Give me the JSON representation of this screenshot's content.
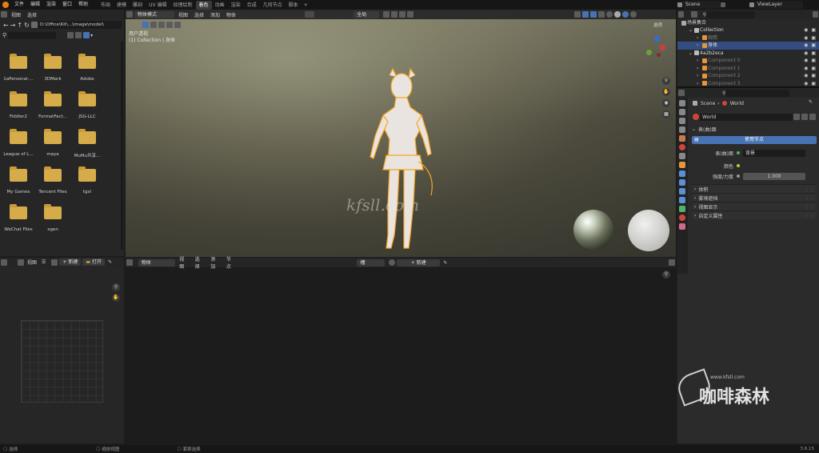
{
  "menu": [
    "文件",
    "编辑",
    "渲染",
    "窗口",
    "帮助"
  ],
  "workspaces": [
    {
      "label": "布局",
      "active": false
    },
    {
      "label": "建模",
      "active": false
    },
    {
      "label": "雕刻",
      "active": false
    },
    {
      "label": "UV 编辑",
      "active": false
    },
    {
      "label": "纹理绘制",
      "active": false
    },
    {
      "label": "着色",
      "active": true
    },
    {
      "label": "动画",
      "active": false
    },
    {
      "label": "渲染",
      "active": false
    },
    {
      "label": "合成",
      "active": false
    },
    {
      "label": "几何节点",
      "active": false
    },
    {
      "label": "脚本",
      "active": false
    }
  ],
  "scene": "Scene",
  "view_layer": "ViewLayer",
  "file_browser": {
    "menu": [
      "视图",
      "选择"
    ],
    "path": "D:\\Office\\Kit\\...\\image\\model\\",
    "folders": [
      "1aPersonal-...",
      "3DMark",
      "Adobe",
      "Fiddler2",
      "FormatFact...",
      "JSG-LLC",
      "League of L...",
      "maya",
      "MuMu共享...",
      "My Games",
      "Tencent Files",
      "tgxl",
      "WeChat Files",
      "xgen"
    ]
  },
  "viewport": {
    "mode": "物体模式",
    "menu": [
      "视图",
      "选择",
      "添加",
      "物体"
    ],
    "transform": "全局",
    "overlay_title": "用户透视",
    "overlay_sub": "(1) Collection | 身体",
    "options": "选项",
    "watermark": "kfsll.com"
  },
  "image_editor": {
    "menu": [
      "视图"
    ],
    "new_label": "新建",
    "open_label": "打开"
  },
  "node_editor": {
    "type": "物体",
    "menu": [
      "视图",
      "选择",
      "添加",
      "节点"
    ],
    "slot": "槽",
    "new_label": "新建"
  },
  "outliner": {
    "root": "场景集合",
    "items": [
      {
        "label": "Collection",
        "depth": 1,
        "selected": false,
        "dim": false
      },
      {
        "label": "眼睛",
        "depth": 2,
        "selected": false,
        "dim": true
      },
      {
        "label": "身体",
        "depth": 2,
        "selected": true,
        "dim": false
      },
      {
        "label": "4a2b2eca",
        "depth": 1,
        "selected": false,
        "dim": false
      },
      {
        "label": "Component 0",
        "depth": 2,
        "selected": false,
        "dim": true
      },
      {
        "label": "Component 1",
        "depth": 2,
        "selected": false,
        "dim": true
      },
      {
        "label": "Component 2",
        "depth": 2,
        "selected": false,
        "dim": true
      },
      {
        "label": "Component 3",
        "depth": 2,
        "selected": false,
        "dim": true
      }
    ]
  },
  "properties": {
    "breadcrumb_scene": "Scene",
    "breadcrumb_world": "World",
    "world_name": "World",
    "surface_header": "表(曲)面",
    "use_nodes": "使用节点",
    "surface_label": "表(曲)面",
    "surface_value": "背景",
    "color_label": "颜色",
    "strength_label": "强度/力度",
    "strength_value": "1.000",
    "sections": [
      "体积",
      "雾境遮挡",
      "视图显示",
      "自定义属性"
    ]
  },
  "status": {
    "left": "选择",
    "mid1": "缩放视图",
    "mid2": "套索选择",
    "version": "3.6.15"
  },
  "logo": {
    "url": "www.kfsll.com",
    "name": "咖啡森林"
  },
  "colors": {
    "accent": "#4772b3",
    "folder": "#d6ab4a",
    "selection": "#334d80",
    "outline": "#f5a623"
  }
}
